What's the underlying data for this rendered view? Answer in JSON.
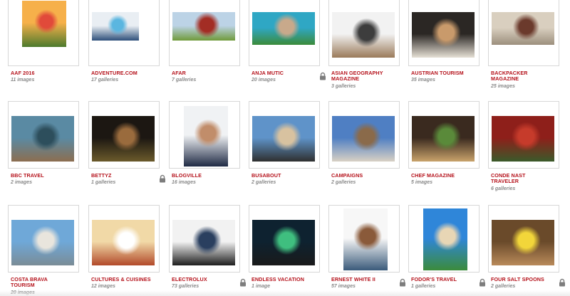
{
  "galleries": [
    {
      "title": "AAF 2016",
      "count": "11 images",
      "locked": false,
      "icon": "hot-air-balloon-photo",
      "colors": [
        "#f6b04a",
        "#e14a3a",
        "#4c7a2d"
      ]
    },
    {
      "title": "ADVENTURE.COM",
      "count": "17 galleries",
      "locked": false,
      "icon": "snow-hiker-photo",
      "colors": [
        "#e9eef3",
        "#5ab6e0",
        "#2e4f7a"
      ]
    },
    {
      "title": "AFAR",
      "count": "7 galleries",
      "locked": false,
      "icon": "red-cottage-photo",
      "colors": [
        "#bcd3e6",
        "#a32d24",
        "#6f9a3a"
      ]
    },
    {
      "title": "ANJA MUTIC",
      "count": "20 images",
      "locked": true,
      "icon": "coast-hiker-photo",
      "colors": [
        "#2fa7c4",
        "#c8a98b",
        "#3b8b3a"
      ]
    },
    {
      "title": "ASIAN GEOGRAPHY MAGAZINE",
      "count": "3 galleries",
      "locked": false,
      "icon": "sled-dogs-photo",
      "colors": [
        "#f2f2f2",
        "#3d3d3d",
        "#9a7a5a"
      ]
    },
    {
      "title": "AUSTRIAN TOURISM",
      "count": "35 images",
      "locked": false,
      "icon": "dinner-table-photo",
      "colors": [
        "#2b2724",
        "#c99a6b",
        "#e6e0d5"
      ]
    },
    {
      "title": "BACKPACKER MAGAZINE",
      "count": "25 images",
      "locked": false,
      "icon": "old-town-street-photo",
      "colors": [
        "#d9cfbf",
        "#6b3a2c",
        "#9c8f7d"
      ]
    },
    {
      "title": "BBC TRAVEL",
      "count": "2 images",
      "locked": false,
      "icon": "fisherman-boat-photo",
      "colors": [
        "#5a8aa3",
        "#2d4e5c",
        "#8c6e50"
      ]
    },
    {
      "title": "BETTYZ",
      "count": "1 galleries",
      "locked": true,
      "icon": "portrait-woman-photo",
      "colors": [
        "#1c1712",
        "#9a6b3d",
        "#6b5a2b"
      ]
    },
    {
      "title": "BLOGVILLE",
      "count": "16 images",
      "locked": false,
      "icon": "smiling-man-portrait-photo",
      "colors": [
        "#f0f2f4",
        "#c18d6a",
        "#1f2a44"
      ]
    },
    {
      "title": "BUSABOUT",
      "count": "2 galleries",
      "locked": false,
      "icon": "beach-jump-photo",
      "colors": [
        "#5f93c9",
        "#d8c2a0",
        "#2f2f2f"
      ]
    },
    {
      "title": "CAMPAIGNS",
      "count": "2 galleries",
      "locked": false,
      "icon": "modern-building-photo",
      "colors": [
        "#4f7fc3",
        "#8a6a4a",
        "#d9d1c4"
      ]
    },
    {
      "title": "CHEF MAGAZINE",
      "count": "5 images",
      "locked": false,
      "icon": "herb-bowl-photo",
      "colors": [
        "#3a2a1f",
        "#5a8a3a",
        "#c9a36b"
      ]
    },
    {
      "title": "CONDE NAST TRAVELER",
      "count": "6 galleries",
      "locked": false,
      "icon": "lobster-photo",
      "colors": [
        "#8e1f1a",
        "#c63b2b",
        "#3a5a2a"
      ]
    },
    {
      "title": "COSTA BRAVA TOURISM",
      "count": "20 images",
      "locked": false,
      "icon": "seaside-woman-photo",
      "colors": [
        "#6fa8d8",
        "#e9e5dd",
        "#7a8c96"
      ]
    },
    {
      "title": "CULTURES & CUISINES",
      "count": "12 images",
      "locked": false,
      "icon": "soup-bowl-photo",
      "colors": [
        "#f1d9a7",
        "#ffffff",
        "#b24a2a"
      ]
    },
    {
      "title": "ELECTROLUX",
      "count": "73 galleries",
      "locked": true,
      "icon": "businessman-photo",
      "colors": [
        "#f2f2f2",
        "#2a3f5f",
        "#1e1e1e"
      ]
    },
    {
      "title": "ENDLESS VACATION",
      "count": "1 image",
      "locked": false,
      "icon": "aurora-photo",
      "colors": [
        "#0e2230",
        "#3fbf7f",
        "#1a1a1a"
      ]
    },
    {
      "title": "ERNEST WHITE II",
      "count": "57 images",
      "locked": true,
      "icon": "bald-man-portrait-photo",
      "colors": [
        "#f7f7f7",
        "#8a5a3a",
        "#3a5a7a"
      ]
    },
    {
      "title": "FODOR'S TRAVEL",
      "count": "1 galleries",
      "locked": true,
      "icon": "palm-beach-photo",
      "colors": [
        "#2f86d9",
        "#e8d6b5",
        "#3b8b3b"
      ]
    },
    {
      "title": "FOUR SALT SPOONS",
      "count": "2 galleries",
      "locked": true,
      "icon": "fruit-vendor-photo",
      "colors": [
        "#6a4a2a",
        "#f2d63a",
        "#b98a5a"
      ]
    }
  ]
}
